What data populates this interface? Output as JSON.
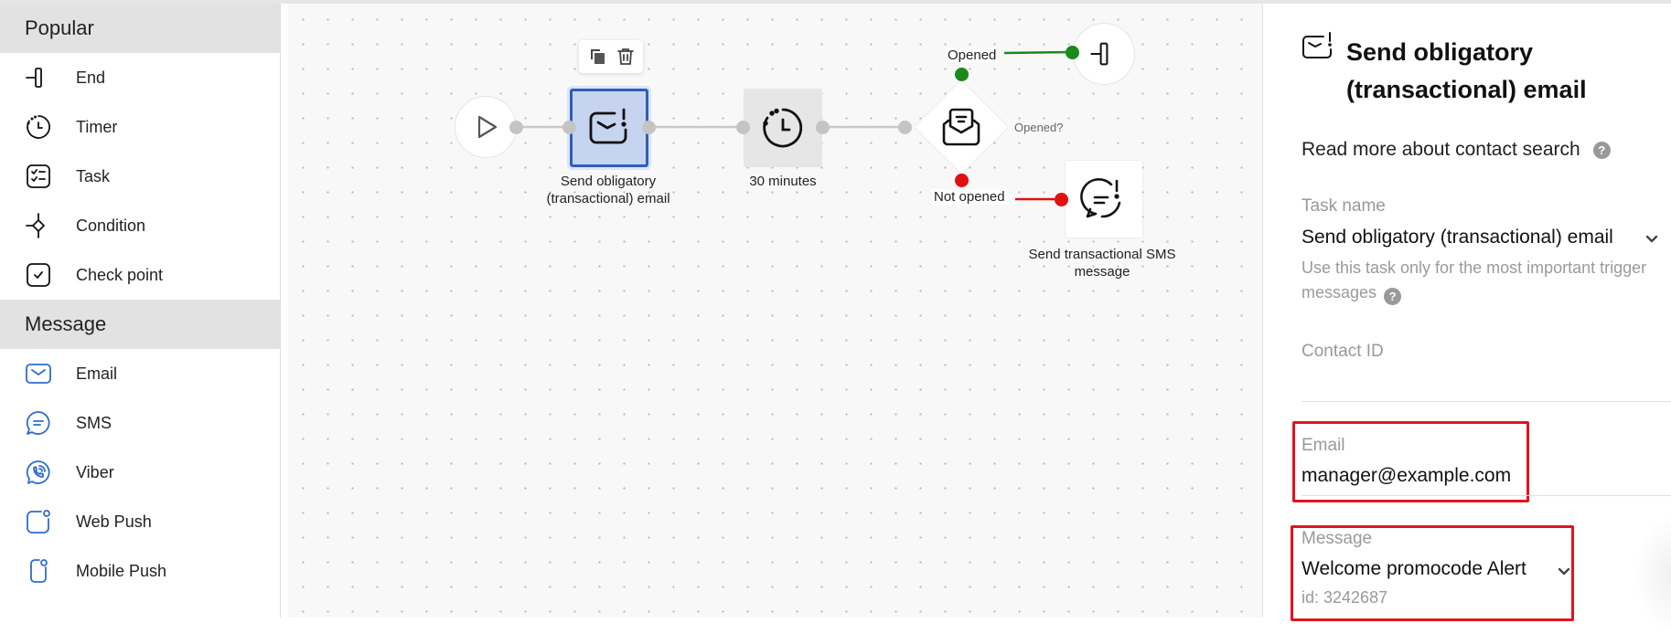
{
  "sidebar": {
    "sections": [
      {
        "title": "Popular",
        "items": [
          {
            "label": "End",
            "icon": "end-icon"
          },
          {
            "label": "Timer",
            "icon": "timer-icon"
          },
          {
            "label": "Task",
            "icon": "task-icon"
          },
          {
            "label": "Condition",
            "icon": "condition-icon"
          },
          {
            "label": "Check point",
            "icon": "checkpoint-icon"
          }
        ]
      },
      {
        "title": "Message",
        "items": [
          {
            "label": "Email",
            "icon": "email-icon"
          },
          {
            "label": "SMS",
            "icon": "sms-icon"
          },
          {
            "label": "Viber",
            "icon": "viber-icon"
          },
          {
            "label": "Web Push",
            "icon": "web-push-icon"
          },
          {
            "label": "Mobile Push",
            "icon": "mobile-push-icon"
          }
        ]
      }
    ]
  },
  "canvas": {
    "toolbar": {
      "copy_icon": "copy-icon",
      "delete_icon": "trash-icon"
    },
    "nodes": {
      "start": {
        "icon": "play-icon"
      },
      "send_email": {
        "label_line1": "Send obligatory",
        "label_line2": "(transactional) email",
        "selected": true
      },
      "timer": {
        "label": "30 minutes"
      },
      "condition": {
        "label": "Opened?",
        "yes_label": "Opened",
        "no_label": "Not opened"
      },
      "end": {
        "icon": "end-icon"
      },
      "send_sms": {
        "label_line1": "Send transactional SMS",
        "label_line2": "message"
      }
    },
    "colors": {
      "yes": "#1a8a1a",
      "no": "#e01010",
      "selected_fill": "#c7d4ef",
      "selected_border": "#2e5fb8"
    }
  },
  "panel": {
    "title": "Send obligatory (transactional) email",
    "read_more": "Read more about contact search",
    "task_name": {
      "label": "Task name",
      "value": "Send obligatory (transactional) email",
      "hint": "Use this task only for the most important trigger messages"
    },
    "contact_id": {
      "label": "Contact ID",
      "value": ""
    },
    "email": {
      "label": "Email",
      "value": "manager@example.com"
    },
    "message": {
      "label": "Message",
      "value": "Welcome promocode Alert",
      "id_text": "id: 3242687"
    },
    "help_glyph": "?",
    "highlight_color": "#e0141e"
  }
}
